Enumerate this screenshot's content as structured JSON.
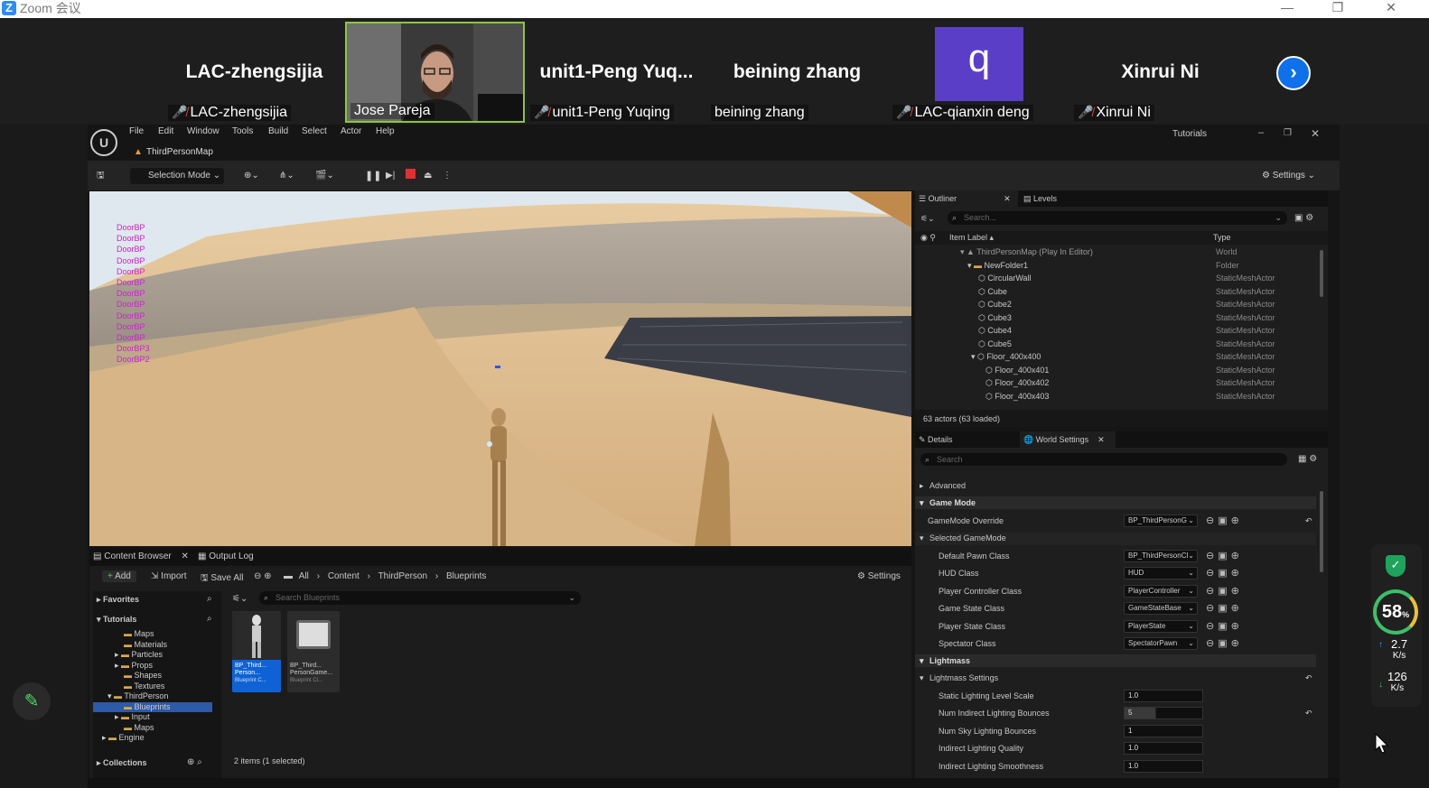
{
  "zoom": {
    "logo": "Z",
    "window_title": "Zoom 会议",
    "controls": [
      "—",
      "❐",
      "✕"
    ],
    "participants": [
      {
        "big": "LAC-zhengsijia",
        "label": "LAC-zhengsijia",
        "muted": true
      },
      {
        "big": "",
        "label": "Jose Pareja",
        "muted": false,
        "video": true
      },
      {
        "big": "unit1-Peng  Yuq...",
        "label": "unit1-Peng Yuqing",
        "muted": true
      },
      {
        "big": "beining zhang",
        "label": "beining zhang",
        "muted": false
      },
      {
        "big": "q",
        "label": "LAC-qianxin deng",
        "muted": true,
        "avatar": true
      },
      {
        "big": "Xinrui Ni",
        "label": "Xinrui Ni",
        "muted": true
      }
    ],
    "next_arrow": "›"
  },
  "ue": {
    "logo": "U",
    "menu": [
      "File",
      "Edit",
      "Window",
      "Tools",
      "Build",
      "Select",
      "Actor",
      "Help"
    ],
    "tab": "ThirdPersonMap",
    "tutorials": "Tutorials",
    "toolbar": {
      "selection_mode": "Selection Mode",
      "settings": "Settings"
    },
    "viewport": {
      "debug_lines": [
        "DoorBP",
        "DoorBP",
        "DoorBP",
        "DoorBP",
        "DoorBP",
        "DoorBP",
        "DoorBP",
        "DoorBP",
        "DoorBP",
        "DoorBP",
        "DoorBP",
        "DoorBP3",
        "DoorBP2"
      ]
    },
    "content_browser": {
      "tab": "Content Browser",
      "tab2": "Output Log",
      "add": "Add",
      "import": "Import",
      "save_all": "Save All",
      "breadcrumb": [
        "All",
        "Content",
        "ThirdPerson",
        "Blueprints"
      ],
      "settings": "Settings",
      "favorites": "Favorites",
      "tutorials": "Tutorials",
      "search_placeholder": "Search Blueprints",
      "tree": [
        {
          "label": "Maps",
          "indent": 1
        },
        {
          "label": "Materials",
          "indent": 1
        },
        {
          "label": "Particles",
          "indent": 1
        },
        {
          "label": "Props",
          "indent": 1
        },
        {
          "label": "Shapes",
          "indent": 1
        },
        {
          "label": "Textures",
          "indent": 1
        },
        {
          "label": "ThirdPerson",
          "indent": 0
        },
        {
          "label": "Blueprints",
          "indent": 1,
          "selected": true
        },
        {
          "label": "Input",
          "indent": 1
        },
        {
          "label": "Maps",
          "indent": 1
        },
        {
          "label": "Engine",
          "indent": 0
        }
      ],
      "collections": "Collections",
      "assets": [
        {
          "name1": "BP_Third...",
          "name2": "Person...",
          "type": "Blueprint C...",
          "selected": true
        },
        {
          "name1": "BP_Third...",
          "name2": "PersonGame...",
          "type": "Blueprint Cl...",
          "selected": false
        }
      ],
      "status": "2 items (1 selected)"
    },
    "outliner": {
      "tab": "Outliner",
      "tab2": "Levels",
      "search_placeholder": "Search...",
      "col_label": "Item Label ▴",
      "col_type": "Type",
      "rows": [
        {
          "label": "ThirdPersonMap (Play In Editor)",
          "type": "World",
          "indent": 0,
          "dim": true
        },
        {
          "label": "NewFolder1",
          "type": "Folder",
          "indent": 1
        },
        {
          "label": "CircularWall",
          "type": "StaticMeshActor",
          "indent": 2
        },
        {
          "label": "Cube",
          "type": "StaticMeshActor",
          "indent": 2
        },
        {
          "label": "Cube2",
          "type": "StaticMeshActor",
          "indent": 2
        },
        {
          "label": "Cube3",
          "type": "StaticMeshActor",
          "indent": 2
        },
        {
          "label": "Cube4",
          "type": "StaticMeshActor",
          "indent": 2
        },
        {
          "label": "Cube5",
          "type": "StaticMeshActor",
          "indent": 2
        },
        {
          "label": "Floor_400x400",
          "type": "StaticMeshActor",
          "indent": 2
        },
        {
          "label": "Floor_400x401",
          "type": "StaticMeshActor",
          "indent": 3
        },
        {
          "label": "Floor_400x402",
          "type": "StaticMeshActor",
          "indent": 3
        },
        {
          "label": "Floor_400x403",
          "type": "StaticMeshActor",
          "indent": 3
        }
      ],
      "status": "63 actors (63 loaded)"
    },
    "details": {
      "tab": "Details",
      "tab2": "World Settings",
      "search_placeholder": "Search",
      "advanced": "Advanced",
      "game_mode": "Game Mode",
      "gamemode_override": {
        "label": "GameMode Override",
        "value": "BP_ThirdPersonG"
      },
      "selected_gamemode": "Selected GameMode",
      "props": [
        {
          "label": "Default Pawn Class",
          "value": "BP_ThirdPersonCl"
        },
        {
          "label": "HUD Class",
          "value": "HUD"
        },
        {
          "label": "Player Controller Class",
          "value": "PlayerController"
        },
        {
          "label": "Game State Class",
          "value": "GameStateBase"
        },
        {
          "label": "Player State Class",
          "value": "PlayerState"
        },
        {
          "label": "Spectator Class",
          "value": "SpectatorPawn"
        }
      ],
      "lightmass": "Lightmass",
      "lightmass_settings": "Lightmass Settings",
      "light_props": [
        {
          "label": "Static Lighting Level Scale",
          "value": "1.0"
        },
        {
          "label": "Num Indirect Lighting Bounces",
          "value": "5"
        },
        {
          "label": "Num Sky Lighting Bounces",
          "value": "1"
        },
        {
          "label": "Indirect Lighting Quality",
          "value": "1.0"
        },
        {
          "label": "Indirect Lighting Smoothness",
          "value": "1.0"
        }
      ]
    }
  },
  "network_widget": {
    "percent": "58",
    "percent_unit": "%",
    "up_value": "2.7",
    "up_unit": "K/s",
    "down_value": "126",
    "down_unit": "K/s"
  }
}
